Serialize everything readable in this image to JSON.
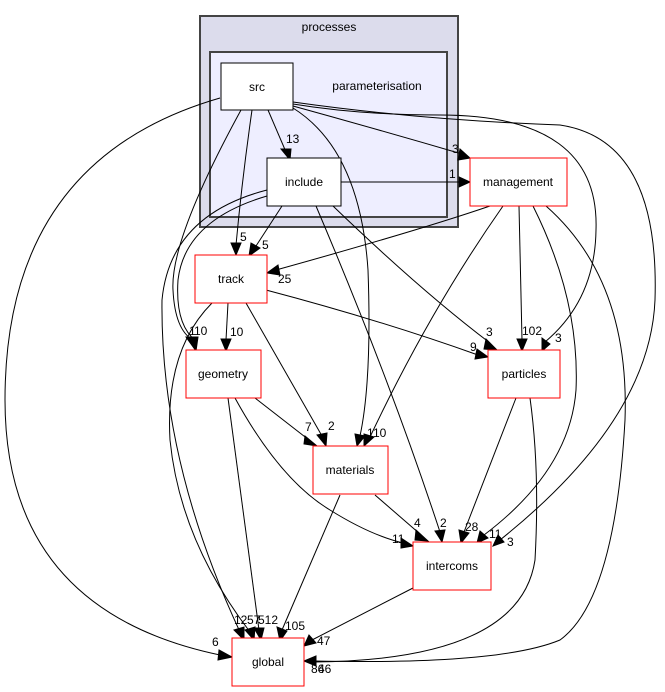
{
  "colors": {
    "outer_cluster_fill": "#dcdcec",
    "outer_cluster_stroke": "#444444",
    "inner_cluster_fill": "#eeeeff",
    "inner_cluster_stroke": "#444444",
    "dir_node_stroke": "#000000",
    "external_node_stroke": "#ff0000",
    "node_fill": "#ffffff"
  },
  "clusters": {
    "outer": {
      "label": "processes"
    },
    "inner": {
      "label": "parameterisation"
    }
  },
  "nodes": {
    "src": {
      "label": "src"
    },
    "include": {
      "label": "include"
    },
    "management": {
      "label": "management"
    },
    "track": {
      "label": "track"
    },
    "geometry": {
      "label": "geometry"
    },
    "particles": {
      "label": "particles"
    },
    "materials": {
      "label": "materials"
    },
    "intercoms": {
      "label": "intercoms"
    },
    "global": {
      "label": "global"
    }
  },
  "edges": [
    {
      "from": "src",
      "to": "include",
      "label": "13"
    },
    {
      "from": "src",
      "to": "management",
      "label": "3"
    },
    {
      "from": "include",
      "to": "management",
      "label": "1"
    },
    {
      "from": "src",
      "to": "track",
      "label": "5"
    },
    {
      "from": "include",
      "to": "track",
      "label": "5"
    },
    {
      "from": "management",
      "to": "track",
      "label": "25"
    },
    {
      "from": "src",
      "to": "geometry",
      "label": "10"
    },
    {
      "from": "include",
      "to": "geometry",
      "label": "1"
    },
    {
      "from": "track",
      "to": "geometry",
      "label": "10"
    },
    {
      "from": "include",
      "to": "particles",
      "label": "3"
    },
    {
      "from": "track",
      "to": "particles",
      "label": "9"
    },
    {
      "from": "management",
      "to": "particles",
      "label": "102"
    },
    {
      "from": "src",
      "to": "particles",
      "label": "3"
    },
    {
      "from": "geometry",
      "to": "materials",
      "label": "7"
    },
    {
      "from": "track",
      "to": "materials",
      "label": "2"
    },
    {
      "from": "src",
      "to": "materials",
      "label": "1"
    },
    {
      "from": "management",
      "to": "materials",
      "label": "10"
    },
    {
      "from": "geometry",
      "to": "intercoms",
      "label": "11"
    },
    {
      "from": "materials",
      "to": "intercoms",
      "label": "4"
    },
    {
      "from": "include",
      "to": "intercoms",
      "label": "2"
    },
    {
      "from": "particles",
      "to": "intercoms",
      "label": "28"
    },
    {
      "from": "management",
      "to": "intercoms",
      "label": "11"
    },
    {
      "from": "src",
      "to": "intercoms",
      "label": "3"
    },
    {
      "from": "src",
      "to": "global",
      "label": "6"
    },
    {
      "from": "include",
      "to": "global",
      "label": "12"
    },
    {
      "from": "track",
      "to": "global",
      "label": "57"
    },
    {
      "from": "geometry",
      "to": "global",
      "label": "512"
    },
    {
      "from": "materials",
      "to": "global",
      "label": "105"
    },
    {
      "from": "intercoms",
      "to": "global",
      "label": "47"
    },
    {
      "from": "particles",
      "to": "global",
      "label": "46"
    },
    {
      "from": "management",
      "to": "global",
      "label": "86"
    }
  ]
}
